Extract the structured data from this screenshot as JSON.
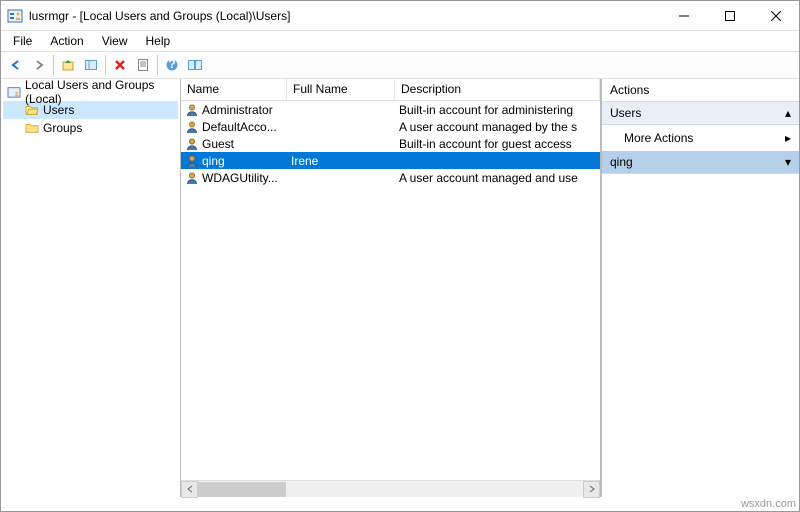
{
  "window": {
    "title": "lusrmgr - [Local Users and Groups (Local)\\Users]"
  },
  "menu": {
    "file": "File",
    "action": "Action",
    "view": "View",
    "help": "Help"
  },
  "tree": {
    "root": "Local Users and Groups (Local)",
    "users": "Users",
    "groups": "Groups"
  },
  "columns": {
    "name": "Name",
    "fullname": "Full Name",
    "description": "Description"
  },
  "rows": [
    {
      "name": "Administrator",
      "full": "",
      "desc": "Built-in account for administering",
      "selected": false
    },
    {
      "name": "DefaultAcco...",
      "full": "",
      "desc": "A user account managed by the s",
      "selected": false
    },
    {
      "name": "Guest",
      "full": "",
      "desc": "Built-in account for guest access",
      "selected": false
    },
    {
      "name": "qing",
      "full": "Irene",
      "desc": "",
      "selected": true
    },
    {
      "name": "WDAGUtility...",
      "full": "",
      "desc": "A user account managed and use",
      "selected": false
    }
  ],
  "actions": {
    "title": "Actions",
    "group1": "Users",
    "moreActions": "More Actions",
    "group2": "qing"
  },
  "brand": "wsxdn.com"
}
